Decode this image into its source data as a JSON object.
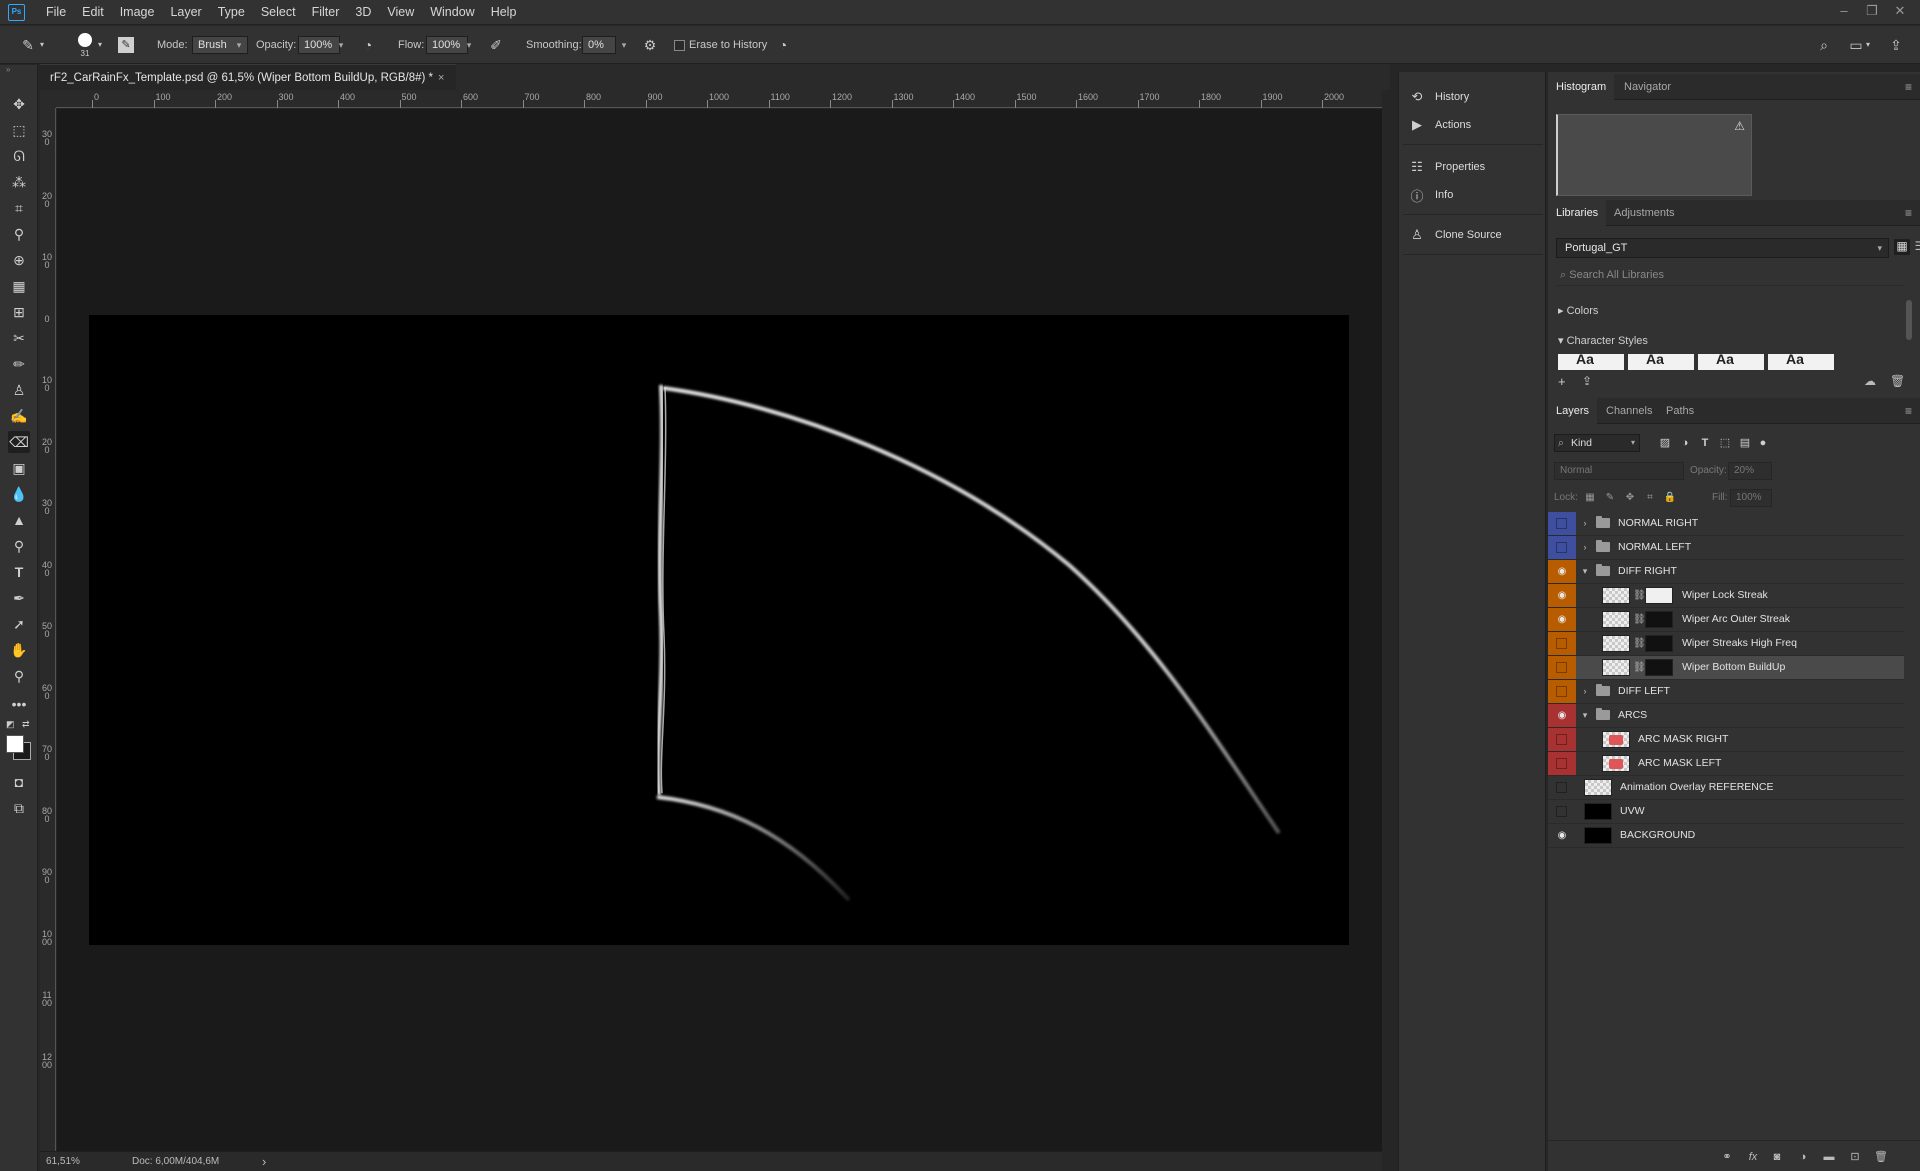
{
  "app": {
    "logo_text": "Ps",
    "menu": [
      "File",
      "Edit",
      "Image",
      "Layer",
      "Type",
      "Select",
      "Filter",
      "3D",
      "View",
      "Window",
      "Help"
    ]
  },
  "options_bar": {
    "brush_size": "31",
    "mode_label": "Mode:",
    "mode_value": "Brush",
    "opacity_label": "Opacity:",
    "opacity_value": "100%",
    "flow_label": "Flow:",
    "flow_value": "100%",
    "smoothing_label": "Smoothing:",
    "smoothing_value": "0%",
    "erase_to_history_label": "Erase to History",
    "erase_to_history_checked": false
  },
  "document": {
    "tab_title": "rF2_CarRainFx_Template.psd @ 61,5% (Wiper Bottom BuildUp, RGB/8#) *",
    "close_glyph": "×",
    "ruler_top_labels": [
      "0",
      "100",
      "200",
      "300",
      "400",
      "500",
      "600",
      "700",
      "800",
      "900",
      "1000",
      "1100",
      "1200",
      "1300",
      "1400",
      "1500",
      "1600",
      "1700",
      "1800",
      "1900",
      "2000"
    ],
    "ruler_left_labels": [
      "300",
      "200",
      "100",
      "0",
      "100",
      "200",
      "300",
      "400",
      "500",
      "600",
      "700",
      "800",
      "900",
      "1000",
      "1100",
      "1200"
    ],
    "zoom": "61,51%",
    "doc_info": "Doc: 6,00M/404,6M",
    "status_arrow": "›"
  },
  "dock": {
    "items": [
      {
        "label": "History",
        "icon": "history-icon"
      },
      {
        "label": "Actions",
        "icon": "play-icon"
      },
      {
        "label": "Properties",
        "icon": "properties-icon"
      },
      {
        "label": "Info",
        "icon": "info-icon"
      },
      {
        "label": "Clone Source",
        "icon": "clone-source-icon"
      }
    ]
  },
  "panels": {
    "top_tabs": [
      "Histogram",
      "Navigator"
    ],
    "lib_tabs": [
      "Libraries",
      "Adjustments"
    ],
    "library_name": "Portugal_GT",
    "search_placeholder": "Search All Libraries",
    "sections": [
      "Colors",
      "Character Styles"
    ],
    "char_style_sample": "Aa",
    "layer_tabs": [
      "Layers",
      "Channels",
      "Paths"
    ]
  },
  "layers_panel": {
    "kind_label": "Kind",
    "blend_mode": "Normal",
    "opacity_label": "Opacity:",
    "opacity_value": "20%",
    "lock_label": "Lock:",
    "fill_label": "Fill:",
    "fill_value": "100%",
    "layers": [
      {
        "name": "NORMAL RIGHT",
        "type": "group",
        "expanded": false,
        "visible": false,
        "color": "#3f4fa0",
        "indent": 0
      },
      {
        "name": "NORMAL LEFT",
        "type": "group",
        "expanded": false,
        "visible": false,
        "color": "#3f4fa0",
        "indent": 0
      },
      {
        "name": "DIFF RIGHT",
        "type": "group",
        "expanded": true,
        "visible": true,
        "color": "#b85c00",
        "indent": 0
      },
      {
        "name": "Wiper Lock Streak",
        "type": "layer",
        "visible": true,
        "color": "#b85c00",
        "indent": 1,
        "mask": "white"
      },
      {
        "name": "Wiper Arc Outer Streak",
        "type": "layer",
        "visible": true,
        "color": "#b85c00",
        "indent": 1,
        "mask": "dark"
      },
      {
        "name": "Wiper Streaks High Freq",
        "type": "layer",
        "visible": false,
        "color": "#b85c00",
        "indent": 1,
        "mask": "dark"
      },
      {
        "name": "Wiper Bottom BuildUp",
        "type": "layer",
        "visible": false,
        "color": "#b85c00",
        "indent": 1,
        "mask": "dark",
        "selected": true
      },
      {
        "name": "DIFF LEFT",
        "type": "group",
        "expanded": false,
        "visible": false,
        "color": "#b85c00",
        "indent": 0
      },
      {
        "name": "ARCS",
        "type": "group",
        "expanded": true,
        "visible": true,
        "color": "#a83232",
        "indent": 0
      },
      {
        "name": "ARC MASK RIGHT",
        "type": "layer",
        "visible": false,
        "color": "#a83232",
        "indent": 1,
        "thumb": "red"
      },
      {
        "name": "ARC MASK LEFT",
        "type": "layer",
        "visible": false,
        "color": "#a83232",
        "indent": 1,
        "thumb": "red"
      },
      {
        "name": "Animation Overlay REFERENCE",
        "type": "layer",
        "visible": false,
        "color": "",
        "indent": 0
      },
      {
        "name": "UVW",
        "type": "layer",
        "visible": false,
        "color": "",
        "indent": 0,
        "thumb": "black"
      },
      {
        "name": "BACKGROUND",
        "type": "layer",
        "visible": true,
        "color": "",
        "indent": 0,
        "thumb": "black"
      }
    ]
  }
}
